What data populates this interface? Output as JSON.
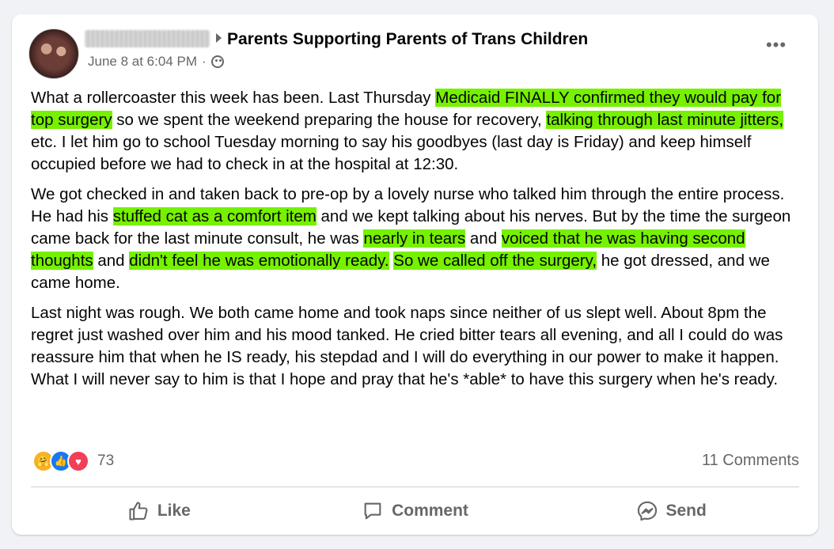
{
  "post": {
    "group_name": "Parents Supporting Parents of Trans Children",
    "timestamp": "June 8 at 6:04 PM",
    "separator": "·",
    "more_label": "•••",
    "paragraphs": [
      [
        {
          "t": "What a rollercoaster this week has been. Last Thursday ",
          "h": false
        },
        {
          "t": "Medicaid FINALLY confirmed they would pay for top surgery",
          "h": true
        },
        {
          "t": " so we spent the weekend preparing the house for recovery, ",
          "h": false
        },
        {
          "t": "talking through last minute jitters,",
          "h": true
        },
        {
          "t": " etc.  I let him go to school Tuesday morning to say his goodbyes (last day is Friday) and keep himself occupied before we had to check in at the hospital at 12:30.",
          "h": false
        }
      ],
      [
        {
          "t": "We got checked in and taken back to pre-op by a lovely nurse who talked him through the entire process. He had his ",
          "h": false
        },
        {
          "t": "stuffed cat as a comfort item",
          "h": true
        },
        {
          "t": " and we kept talking about his nerves. But by the time the surgeon came back for the last minute consult, he was ",
          "h": false
        },
        {
          "t": "nearly in tears",
          "h": true
        },
        {
          "t": " and ",
          "h": false
        },
        {
          "t": "voiced that he was having second thoughts",
          "h": true
        },
        {
          "t": " and ",
          "h": false
        },
        {
          "t": "didn't feel he was emotionally ready.",
          "h": true
        },
        {
          "t": " ",
          "h": false
        },
        {
          "t": "So we called off the surgery,",
          "h": true
        },
        {
          "t": " he got dressed, and we came home.",
          "h": false
        }
      ],
      [
        {
          "t": "Last night was rough. We both came home and took naps since neither of us slept well. About 8pm the regret just washed over him and his mood tanked. He cried bitter tears all evening, and all I could do was reassure him that when he IS ready, his stepdad and I will do everything in our power to make it happen. What I will never say to him is that I hope and pray that he's *able* to have this surgery when he's ready.",
          "h": false
        }
      ]
    ],
    "highlight_color": "#76f100",
    "reactions": [
      "care-emoji-icon",
      "like-emoji-icon",
      "love-emoji-icon"
    ],
    "reaction_count": "73",
    "comments_count": "11 Comments"
  },
  "actions": {
    "like": "Like",
    "comment": "Comment",
    "send": "Send"
  }
}
